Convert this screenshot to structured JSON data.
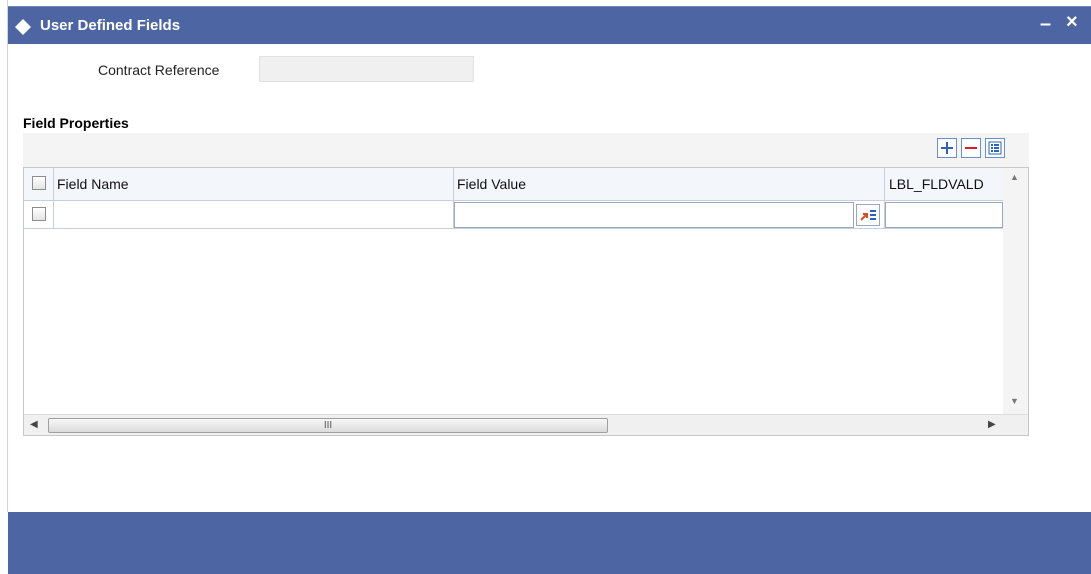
{
  "window": {
    "title": "User Defined Fields",
    "minimize_label": "–",
    "close_label": "×"
  },
  "form": {
    "contract_reference_label": "Contract Reference",
    "contract_reference_value": ""
  },
  "section": {
    "title": "Field Properties"
  },
  "grid": {
    "toolbar": {
      "add_icon": "plus-icon",
      "delete_icon": "minus-icon",
      "list_icon": "list-view-icon"
    },
    "columns": [
      "Field Name",
      "Field Value",
      "LBL_FLDVALD"
    ],
    "rows": [
      {
        "field_name": "",
        "field_value": "",
        "lbl_fldvald": ""
      }
    ],
    "hscroll_grip": "III"
  },
  "colors": {
    "titlebar": "#4d66a3",
    "footer": "#4d66a3",
    "accent_border": "#6d8fc7",
    "lov_arrow": "#e04a1a"
  }
}
